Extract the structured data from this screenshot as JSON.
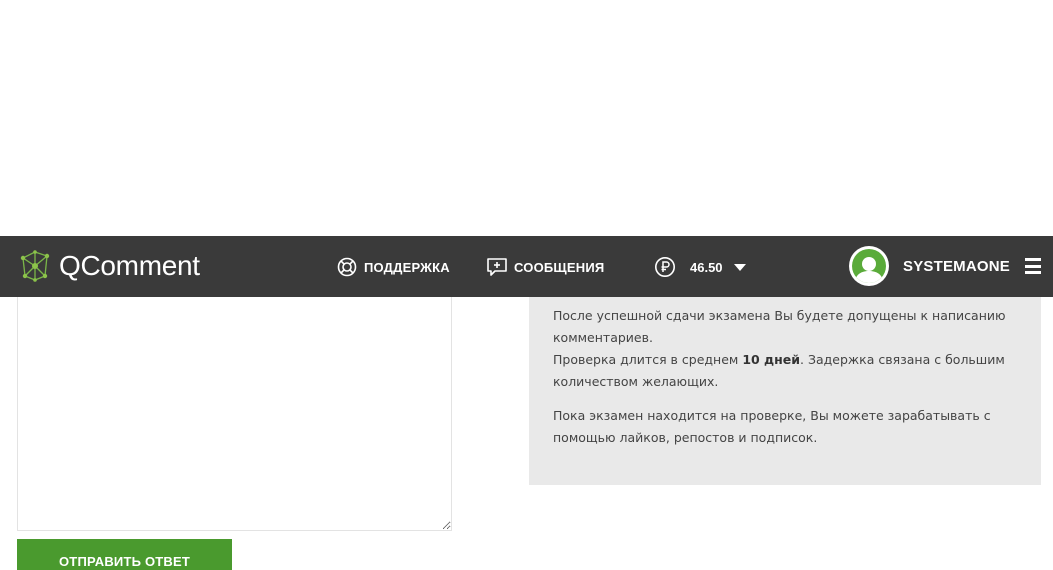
{
  "header": {
    "brand": "QComment",
    "support_label": "ПОДДЕРЖКА",
    "messages_label": "СООБЩЕНИЯ",
    "balance": "46.50",
    "username": "SYSTEMAONE",
    "icons": [
      "qcomment-logo-icon",
      "lifebuoy-icon",
      "message-plus-icon",
      "ruble-icon",
      "caret-down-icon",
      "avatar-icon",
      "hamburger-menu-icon"
    ]
  },
  "form": {
    "answer_value": "",
    "submit_label": "ОТПРАВИТЬ ОТВЕТ"
  },
  "info": {
    "line1": "После успешной сдачи экзамена Вы будете допущены к написанию комментариев.",
    "line2_prefix": "Проверка длится в среднем ",
    "line2_bold": "10 дней",
    "line2_suffix": ". Задержка связана с большим количеством желающих.",
    "line3": "Пока экзамен находится на проверке, Вы можете зарабатывать с помощью лайков, репостов и подписок."
  },
  "colors": {
    "header_bg": "#3a3a3a",
    "accent_green": "#4a9a2e",
    "panel_bg": "#e9e9e9"
  }
}
